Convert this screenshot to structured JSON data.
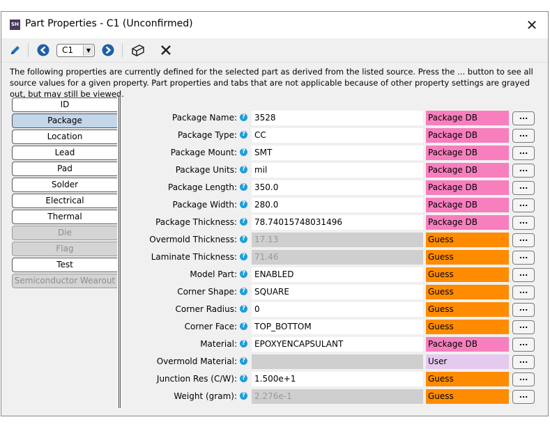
{
  "window": {
    "app_icon_text": "SH",
    "title": "Part Properties - C1 (Unconfirmed)",
    "close_glyph": "✕"
  },
  "toolbar": {
    "part_select": "C1",
    "icons": [
      "pencil-icon",
      "back-arrow-icon",
      "forward-arrow-icon",
      "3d-box-icon",
      "close-icon"
    ],
    "close_glyph": "✕"
  },
  "description": "The following properties are currently defined for the selected part as derived from the listed source. Press the ... button to see all source values for a given property. Part properties and tabs that are not applicable because of other property settings are grayed out, but may still be viewed.",
  "tabs": [
    {
      "label": "ID",
      "state": "normal"
    },
    {
      "label": "Package",
      "state": "active"
    },
    {
      "label": "Location",
      "state": "normal"
    },
    {
      "label": "Lead",
      "state": "normal"
    },
    {
      "label": "Pad",
      "state": "normal"
    },
    {
      "label": "Solder",
      "state": "normal"
    },
    {
      "label": "Electrical",
      "state": "normal"
    },
    {
      "label": "Thermal",
      "state": "normal"
    },
    {
      "label": "Die",
      "state": "disabled"
    },
    {
      "label": "Flag",
      "state": "disabled"
    },
    {
      "label": "Test",
      "state": "normal"
    },
    {
      "label": "Semiconductor Wearout",
      "state": "disabled"
    }
  ],
  "help_glyph": "?",
  "more_label": "...",
  "source_colors": {
    "Package DB": "#f77fbe",
    "Guess": "#ff8c00",
    "User": "#e6c9ef"
  },
  "properties": [
    {
      "label": "Package Name:",
      "value": "3528",
      "source": "Package DB",
      "disabled": false
    },
    {
      "label": "Package Type:",
      "value": "CC",
      "source": "Package DB",
      "disabled": false
    },
    {
      "label": "Package Mount:",
      "value": "SMT",
      "source": "Package DB",
      "disabled": false
    },
    {
      "label": "Package Units:",
      "value": "mil",
      "source": "Package DB",
      "disabled": false
    },
    {
      "label": "Package Length:",
      "value": "350.0",
      "source": "Package DB",
      "disabled": false
    },
    {
      "label": "Package Width:",
      "value": "280.0",
      "source": "Package DB",
      "disabled": false
    },
    {
      "label": "Package Thickness:",
      "value": "78.74015748031496",
      "source": "Package DB",
      "disabled": false
    },
    {
      "label": "Overmold Thickness:",
      "value": "17.13",
      "source": "Guess",
      "disabled": true
    },
    {
      "label": "Laminate Thickness:",
      "value": "71.46",
      "source": "Guess",
      "disabled": true
    },
    {
      "label": "Model Part:",
      "value": "ENABLED",
      "source": "Guess",
      "disabled": false
    },
    {
      "label": "Corner Shape:",
      "value": "SQUARE",
      "source": "Guess",
      "disabled": false
    },
    {
      "label": "Corner Radius:",
      "value": "0",
      "source": "Guess",
      "disabled": false
    },
    {
      "label": "Corner Face:",
      "value": "TOP_BOTTOM",
      "source": "Guess",
      "disabled": false
    },
    {
      "label": "Material:",
      "value": "EPOXYENCAPSULANT",
      "source": "Package DB",
      "disabled": false
    },
    {
      "label": "Overmold Material:",
      "value": "",
      "source": "User",
      "disabled": true
    },
    {
      "label": "Junction Res (C/W):",
      "value": "1.500e+1",
      "source": "Guess",
      "disabled": false
    },
    {
      "label": "Weight (gram):",
      "value": "2.276e-1",
      "source": "Guess",
      "disabled": true
    }
  ]
}
